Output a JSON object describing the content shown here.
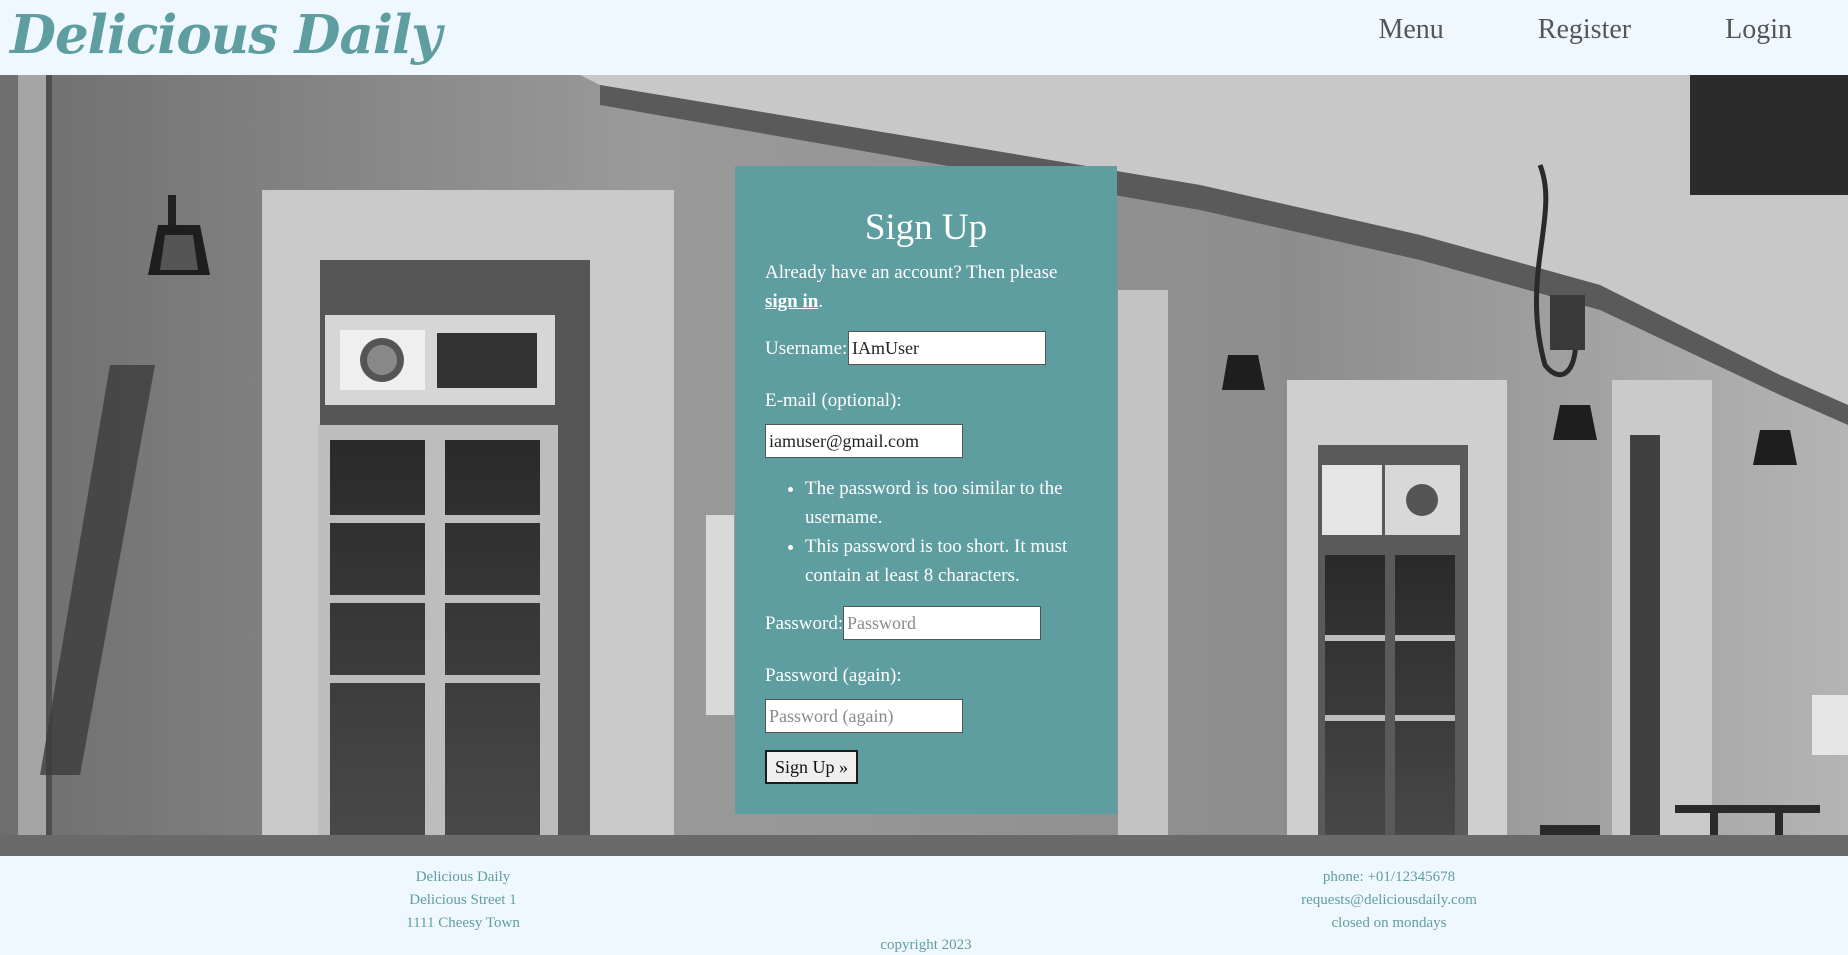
{
  "header": {
    "brand": "Delicious Daily",
    "nav": {
      "menu": "Menu",
      "register": "Register",
      "login": "Login"
    }
  },
  "signup": {
    "title": "Sign Up",
    "intro_text": "Already have an account? Then please ",
    "intro_link": "sign in",
    "intro_end": ".",
    "username_label": "Username:",
    "username_value": "IAmUser",
    "email_label": "E-mail (optional):",
    "email_value": "iamuser@gmail.com",
    "errors": [
      "The password is too similar to the username.",
      "This password is too short. It must contain at least 8 characters."
    ],
    "password_label": "Password:",
    "password_placeholder": "Password",
    "password_again_label": "Password (again):",
    "password_again_placeholder": "Password (again)",
    "submit_label": "Sign Up »"
  },
  "footer": {
    "left": {
      "name": "Delicious Daily",
      "street": "Delicious Street 1",
      "town": "1111 Cheesy Town"
    },
    "right": {
      "phone": "phone: +01/12345678",
      "email": "requests@deliciousdaily.com",
      "hours": "closed on mondays"
    },
    "copyright": "copyright 2023"
  },
  "colors": {
    "accent": "#5f9ea0",
    "page_background": "#f0f8ff",
    "nav_text": "#555555"
  }
}
